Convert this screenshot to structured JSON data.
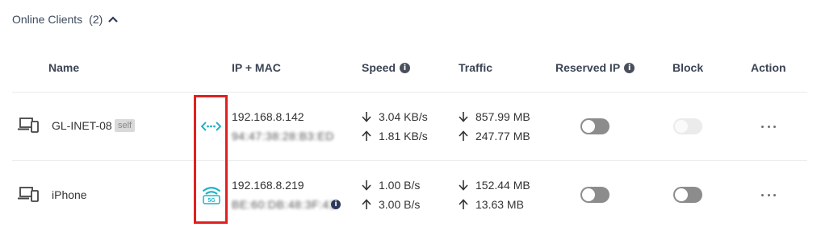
{
  "section": {
    "title": "Online Clients",
    "count": "(2)"
  },
  "columns": {
    "name": "Name",
    "ip_mac": "IP + MAC",
    "speed": "Speed",
    "traffic": "Traffic",
    "reserved_ip": "Reserved IP",
    "block": "Block",
    "action": "Action"
  },
  "clients": [
    {
      "name": "GL-INET-08",
      "badge": "self",
      "connection_icon": "ethernet-icon",
      "ip": "192.168.8.142",
      "mac": "94:47:38:28:B3:ED",
      "speed_down": "3.04 KB/s",
      "speed_up": "1.81 KB/s",
      "traffic_down": "857.99 MB",
      "traffic_up": "247.77 MB",
      "reserved_ip": false,
      "block": false,
      "block_disabled": true
    },
    {
      "name": "iPhone",
      "connection_icon": "wifi-5g-icon",
      "connection_label": "5G",
      "ip": "192.168.8.219",
      "mac": "BE:60:DB:48:3F:41",
      "speed_down": "1.00 B/s",
      "speed_up": "3.00 B/s",
      "traffic_down": "152.44 MB",
      "traffic_up": "13.63 MB",
      "reserved_ip": false,
      "block": false,
      "block_disabled": false
    }
  ],
  "colors": {
    "accent": "#1fb3c8",
    "highlight": "#e02020",
    "toggle_off": "#8c8c8c"
  }
}
